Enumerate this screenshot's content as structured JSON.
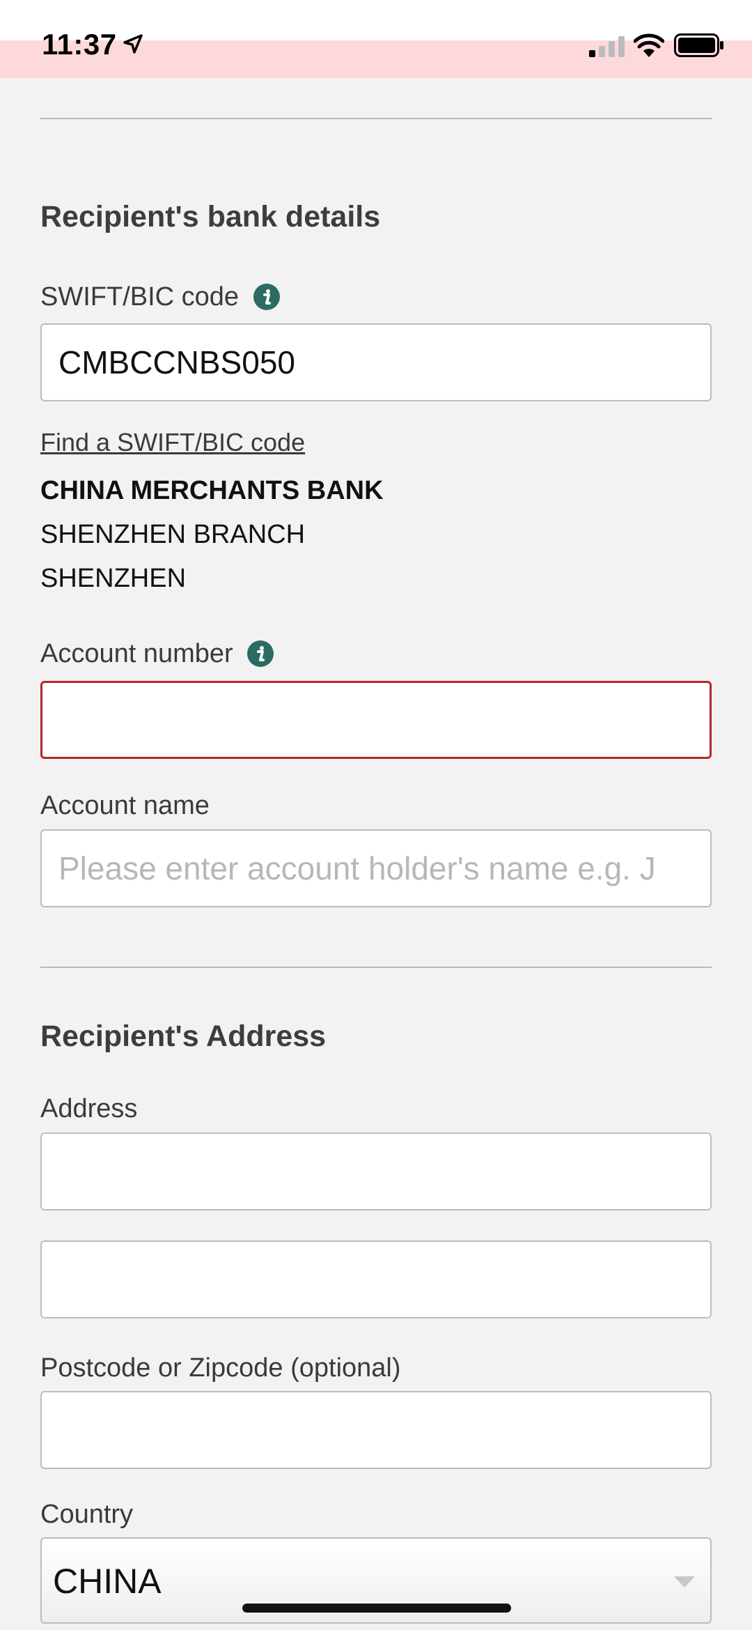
{
  "status_bar": {
    "time": "11:37"
  },
  "bank_section": {
    "title": "Recipient's bank details",
    "swift_label": "SWIFT/BIC code",
    "swift_value": "CMBCCNBS050",
    "find_swift_link": "Find a SWIFT/BIC code",
    "bank_name": "CHINA MERCHANTS BANK",
    "bank_branch": "SHENZHEN BRANCH",
    "bank_city": "SHENZHEN",
    "account_number_label": "Account number",
    "account_number_value": "",
    "account_name_label": "Account name",
    "account_name_placeholder": "Please enter account holder's name e.g. J"
  },
  "address_section": {
    "title": "Recipient's Address",
    "address_label": "Address",
    "address_line1": "",
    "address_line2": "",
    "postcode_label": "Postcode or Zipcode  (optional)",
    "postcode_value": "",
    "country_label": "Country",
    "country_value": "CHINA"
  },
  "colors": {
    "error_border": "#b7252b",
    "info_icon": "#2b6b63",
    "status_tint": "#fdd9dc"
  },
  "icons": [
    "location-arrow-icon",
    "cellular-signal-icon",
    "wifi-icon",
    "battery-icon",
    "info-icon",
    "dropdown-caret-icon"
  ]
}
